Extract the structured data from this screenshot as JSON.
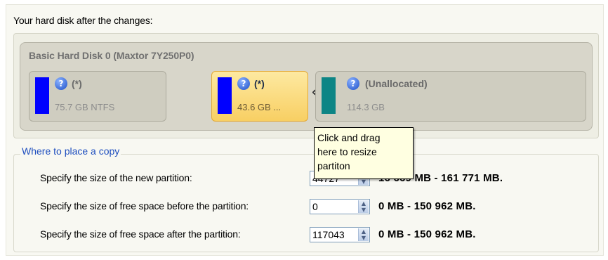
{
  "header": {
    "label": "Your hard disk after the changes:"
  },
  "disk": {
    "title": "Basic Hard Disk 0 (Maxtor 7Y250P0)",
    "partitions": [
      {
        "name": "(*)",
        "size": "75.7 GB NTFS",
        "bar_color": "#0000ff"
      },
      {
        "name": "(*)",
        "size": "43.6 GB ...",
        "bar_color": "#0000ff",
        "selected": true
      },
      {
        "name": "(Unallocated)",
        "size": "114.3 GB",
        "bar_color": "#0d8585"
      }
    ]
  },
  "tooltip": {
    "lines": [
      "Click and drag",
      "here to resize",
      "partiton"
    ]
  },
  "copy_group": {
    "title": "Where to place a copy",
    "rows": [
      {
        "label": "Specify the size of the new partition:",
        "value": "44727",
        "range": "16 669 MB - 161 771 MB."
      },
      {
        "label": "Specify the size of free space before the partition:",
        "value": "0",
        "range": "0 MB - 150 962 MB."
      },
      {
        "label": "Specify the size of free space after the partition:",
        "value": "117043",
        "range": "0 MB - 150 962 MB."
      }
    ]
  },
  "icons": {
    "help": "help-icon",
    "resize": "resize-arrows-icon",
    "spin": "spin-arrows-icon"
  },
  "colors": {
    "selected_partition": "#f8cf63",
    "group_title": "#1f4fbf",
    "tooltip_bg": "#ffffe1"
  }
}
